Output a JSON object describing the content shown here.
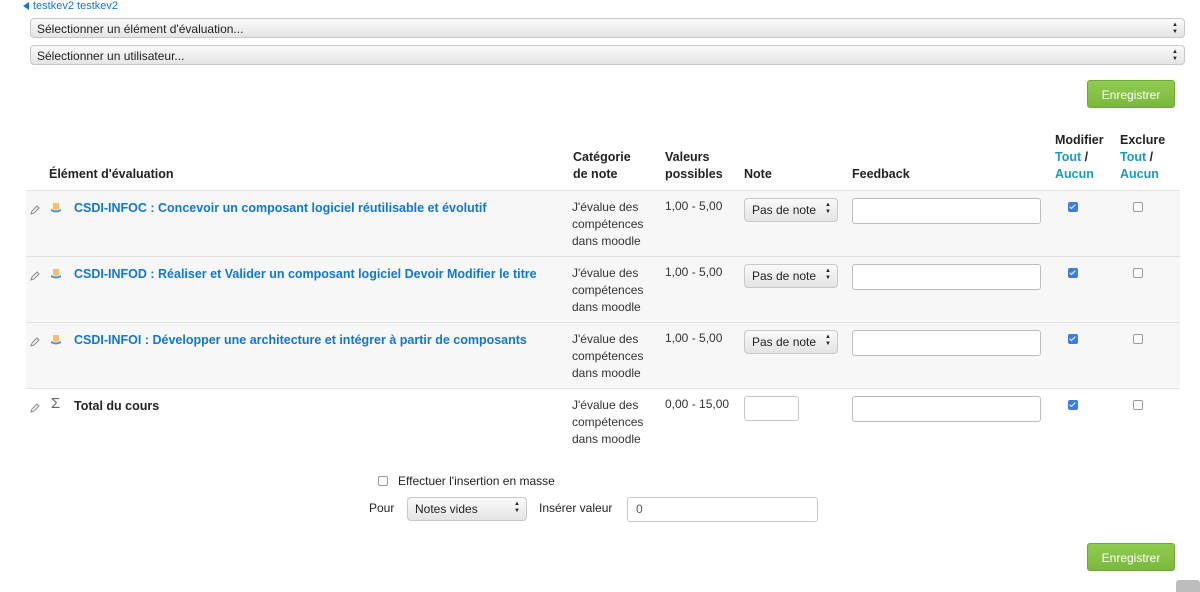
{
  "breadcrumb": {
    "back_label": "testkev2 testkev2"
  },
  "selectors": {
    "grade_item": "Sélectionner un élément d'évaluation...",
    "user": "Sélectionner un utilisateur..."
  },
  "actions": {
    "save_label": "Enregistrer"
  },
  "table": {
    "headers": {
      "item": "Élément d'évaluation",
      "category_line1": "Catégorie",
      "category_line2": "de note",
      "range_line1": "Valeurs",
      "range_line2": "possibles",
      "grade": "Note",
      "feedback": "Feedback",
      "modify": "Modifier",
      "exclude": "Exclure",
      "all": "Tout",
      "slash": "/",
      "none": "Aucun"
    },
    "rows": [
      {
        "name": "CSDI-INFOC : Concevoir un composant logiciel réutilisable et évolutif",
        "category": "J'évalue des compétences dans moodle",
        "range": "1,00 - 5,00",
        "grade": "Pas de note",
        "modify_checked": true,
        "exclude_checked": false
      },
      {
        "name": "CSDI-INFOD : Réaliser et Valider un composant logiciel Devoir Modifier le titre",
        "category": "J'évalue des compétences dans moodle",
        "range": "1,00 - 5,00",
        "grade": "Pas de note",
        "modify_checked": true,
        "exclude_checked": false
      },
      {
        "name": "CSDI-INFOI : Développer une architecture et intégrer à partir de composants",
        "category": "J'évalue des compétences dans moodle",
        "range": "1,00 - 5,00",
        "grade": "Pas de note",
        "modify_checked": true,
        "exclude_checked": false
      },
      {
        "name": "Total du cours",
        "category": "J'évalue des compétences dans moodle",
        "range": "0,00 - 15,00",
        "grade": "",
        "modify_checked": true,
        "exclude_checked": false
      }
    ]
  },
  "bulk": {
    "checkbox_label": "Effectuer l'insertion en masse",
    "for_label": "Pour",
    "for_value": "Notes vides",
    "insert_label": "Insérer valeur",
    "insert_value": "0"
  },
  "icons": {
    "edit": "pencil-icon",
    "assignment": "assignment-icon",
    "total": "sigma-icon"
  },
  "colors": {
    "link": "#1177d1",
    "save_button": "#8bc34a",
    "checkbox_checked": "#3d7ed8"
  }
}
